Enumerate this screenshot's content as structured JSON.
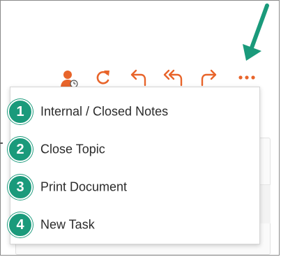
{
  "colors": {
    "accent": "#e8642a",
    "badge": "#1a9a7b",
    "callout_arrow": "#1a9a7b"
  },
  "toolbar": {
    "buttons": [
      {
        "name": "assign-user",
        "icon": "user-clock-icon"
      },
      {
        "name": "refresh",
        "icon": "refresh-icon"
      },
      {
        "name": "reply",
        "icon": "reply-icon"
      },
      {
        "name": "reply-all",
        "icon": "reply-all-icon"
      },
      {
        "name": "forward",
        "icon": "forward-icon"
      },
      {
        "name": "more",
        "icon": "more-horizontal-icon"
      }
    ]
  },
  "menu": {
    "items": [
      {
        "number": "1",
        "label": "Internal / Closed Notes"
      },
      {
        "number": "2",
        "label": "Close Topic"
      },
      {
        "number": "3",
        "label": "Print Document"
      },
      {
        "number": "4",
        "label": "New Task"
      }
    ]
  }
}
